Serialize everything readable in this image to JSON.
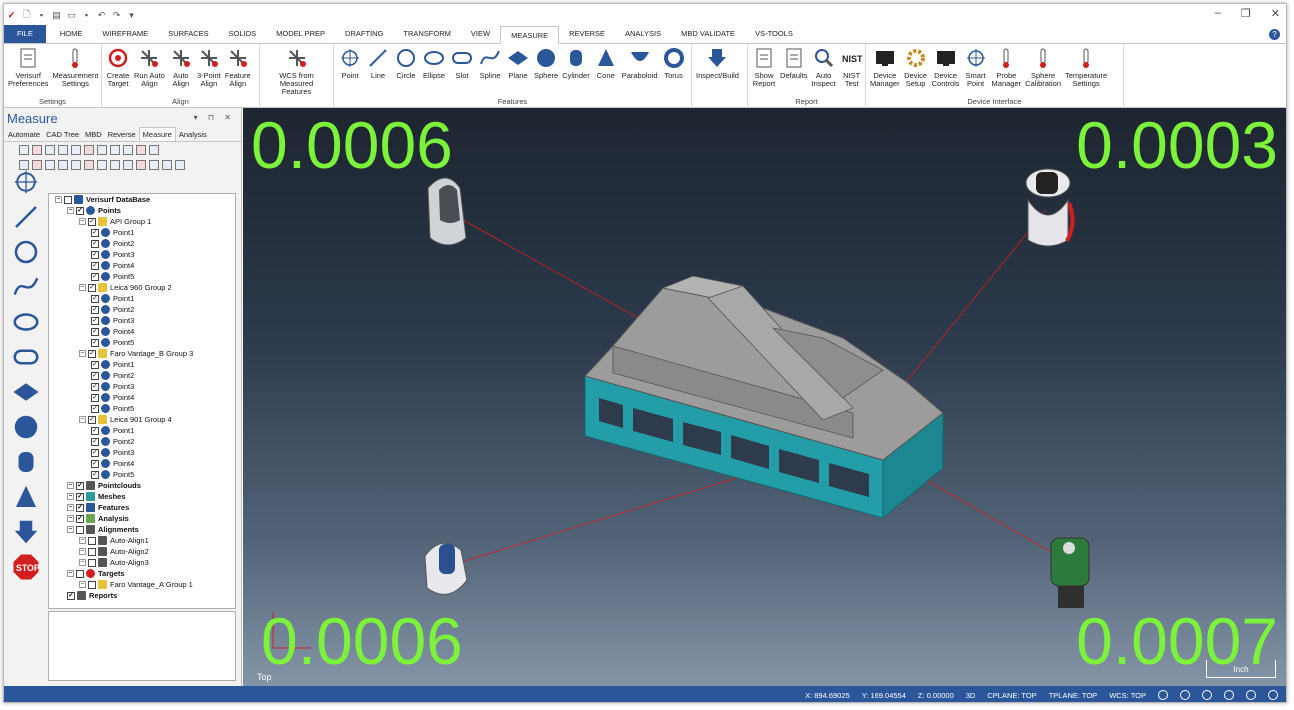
{
  "ribbon_tabs": [
    "FILE",
    "HOME",
    "WIREFRAME",
    "SURFACES",
    "SOLIDS",
    "MODEL PREP",
    "DRAFTING",
    "TRANSFORM",
    "VIEW",
    "MEASURE",
    "REVERSE",
    "ANALYSIS",
    "MBD VALIDATE",
    "VS-TOOLS"
  ],
  "active_tab": "MEASURE",
  "groups": {
    "settings": {
      "label": "Settings",
      "buttons": [
        "Verisurf\nPreferences",
        "Measurement\nSettings"
      ]
    },
    "align": {
      "label": "Align",
      "buttons": [
        "Create\nTarget",
        "Run Auto\nAlign",
        "Auto\nAlign",
        "3-Point\nAlign",
        "Feature\nAlign"
      ]
    },
    "wcs": {
      "label": "",
      "buttons": [
        "WCS from\nMeasured Features"
      ]
    },
    "features": {
      "label": "Features",
      "buttons": [
        "Point",
        "Line",
        "Circle",
        "Ellipse",
        "Slot",
        "Spline",
        "Plane",
        "Sphere",
        "Cylinder",
        "Cone",
        "Paraboloid",
        "Torus"
      ]
    },
    "inspect": {
      "label": "",
      "buttons": [
        "Inspect/Build"
      ]
    },
    "report": {
      "label": "Report",
      "buttons": [
        "Show\nReport",
        "Defaults",
        "Auto\nInspect",
        "NIST\nTest"
      ]
    },
    "device": {
      "label": "Device Interface",
      "buttons": [
        "Device\nManager",
        "Device\nSetup",
        "Device\nControls",
        "Smart\nPoint",
        "Probe\nManager",
        "Sphere\nCalibration",
        "Temperature\nSettings"
      ]
    }
  },
  "panel": {
    "title": "Measure",
    "tabs": [
      "Automate",
      "CAD Tree",
      "MBD",
      "Reverse",
      "Measure",
      "Analysis"
    ],
    "active_tab": "Measure"
  },
  "tree": [
    {
      "label": "Verisurf DataBase",
      "level": 0,
      "bold": true,
      "icon": "database-icon"
    },
    {
      "label": "Points",
      "level": 1,
      "bold": true,
      "icon": "point-icon"
    },
    {
      "label": "API Group 1",
      "level": 2,
      "icon": "folder-icon"
    },
    {
      "label": "Point1",
      "level": 3,
      "icon": "point-icon"
    },
    {
      "label": "Point2",
      "level": 3,
      "icon": "point-icon"
    },
    {
      "label": "Point3",
      "level": 3,
      "icon": "point-icon"
    },
    {
      "label": "Point4",
      "level": 3,
      "icon": "point-icon"
    },
    {
      "label": "Point5",
      "level": 3,
      "icon": "point-icon"
    },
    {
      "label": "Leica 960 Group 2",
      "level": 2,
      "icon": "folder-icon"
    },
    {
      "label": "Point1",
      "level": 3,
      "icon": "point-icon"
    },
    {
      "label": "Point2",
      "level": 3,
      "icon": "point-icon"
    },
    {
      "label": "Point3",
      "level": 3,
      "icon": "point-icon"
    },
    {
      "label": "Point4",
      "level": 3,
      "icon": "point-icon"
    },
    {
      "label": "Point5",
      "level": 3,
      "icon": "point-icon"
    },
    {
      "label": "Faro Vantage_B Group 3",
      "level": 2,
      "icon": "folder-icon"
    },
    {
      "label": "Point1",
      "level": 3,
      "icon": "point-icon"
    },
    {
      "label": "Point2",
      "level": 3,
      "icon": "point-icon"
    },
    {
      "label": "Point3",
      "level": 3,
      "icon": "point-icon"
    },
    {
      "label": "Point4",
      "level": 3,
      "icon": "point-icon"
    },
    {
      "label": "Point5",
      "level": 3,
      "icon": "point-icon"
    },
    {
      "label": "Leica 901 Group 4",
      "level": 2,
      "icon": "folder-icon"
    },
    {
      "label": "Point1",
      "level": 3,
      "icon": "point-icon"
    },
    {
      "label": "Point2",
      "level": 3,
      "icon": "point-icon"
    },
    {
      "label": "Point3",
      "level": 3,
      "icon": "point-icon"
    },
    {
      "label": "Point4",
      "level": 3,
      "icon": "point-icon"
    },
    {
      "label": "Point5",
      "level": 3,
      "icon": "point-icon"
    },
    {
      "label": "Pointclouds",
      "level": 1,
      "bold": true,
      "icon": "pointcloud-icon"
    },
    {
      "label": "Meshes",
      "level": 1,
      "bold": true,
      "icon": "mesh-icon"
    },
    {
      "label": "Features",
      "level": 1,
      "bold": true,
      "icon": "features-icon"
    },
    {
      "label": "Analysis",
      "level": 1,
      "bold": true,
      "icon": "analysis-icon"
    },
    {
      "label": "Alignments",
      "level": 1,
      "bold": true,
      "icon": "alignment-icon"
    },
    {
      "label": "Auto-Align1",
      "level": 2,
      "icon": "alignment-icon"
    },
    {
      "label": "Auto-Align2",
      "level": 2,
      "icon": "alignment-icon"
    },
    {
      "label": "Auto-Align3",
      "level": 2,
      "icon": "alignment-icon"
    },
    {
      "label": "Targets",
      "level": 1,
      "bold": true,
      "icon": "target-icon"
    },
    {
      "label": "Faro Vantage_A Group 1",
      "level": 2,
      "icon": "folder-icon"
    },
    {
      "label": "Reports",
      "level": 1,
      "bold": true,
      "icon": "report-icon"
    }
  ],
  "viewport": {
    "values": {
      "top_left": "0.0006",
      "top_right": "0.0003",
      "bottom_left": "0.0006",
      "bottom_right": "0.0007"
    },
    "view_label": "Top",
    "scale_label": "Inch",
    "value_color": "#7cf23a"
  },
  "status": {
    "x": "X:  894.69025",
    "y": "Y:  169.04554",
    "z": "Z:  0.00000",
    "mode": "3D",
    "cplane": "CPLANE: TOP",
    "tplane": "TPLANE: TOP",
    "wcs": "WCS: TOP"
  }
}
